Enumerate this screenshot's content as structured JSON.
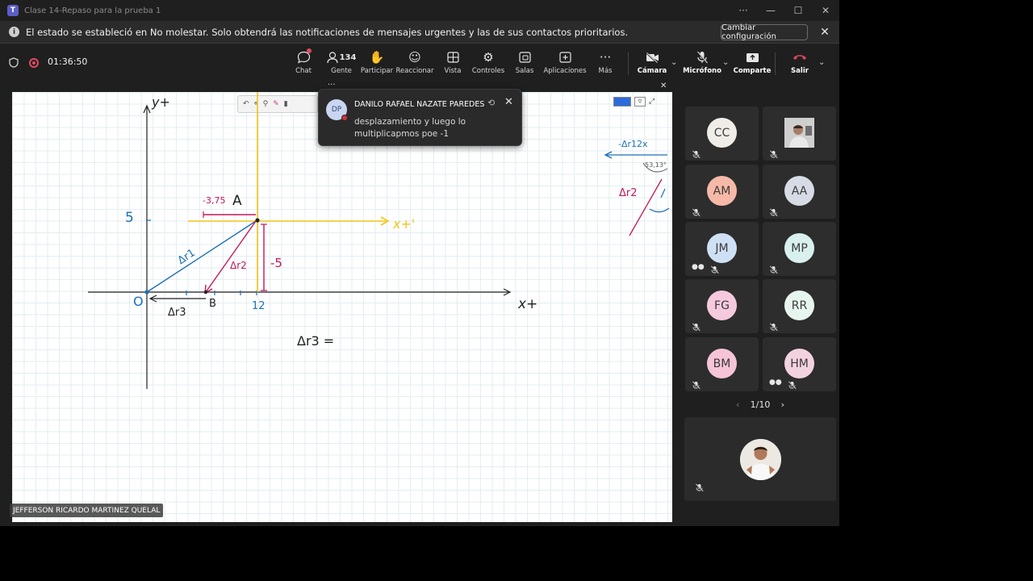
{
  "window": {
    "title": "Clase 14-Repaso para la prueba 1"
  },
  "banner": {
    "message": "El estado se estableció en No molestar. Solo obtendrá las notificaciones de mensajes urgentes y las de sus contactos prioritarios.",
    "config_label": "Cambiar configuración"
  },
  "meeting": {
    "timer": "01:36:50"
  },
  "toolbar": {
    "chat": "Chat",
    "people": "Gente",
    "people_count": "134",
    "raise": "Participar",
    "react": "Reaccionar",
    "view": "Vista",
    "controls": "Controles",
    "rooms": "Salas",
    "apps": "Aplicaciones",
    "more": "Más",
    "camera": "Cámara",
    "mic": "Micrófono",
    "share": "Comparte",
    "leave": "Salir"
  },
  "toast": {
    "initials": "DP",
    "sender": "DANILO RAFAEL NAZATE PAREDES",
    "message": "desplazamiento y luego lo multiplicapmos poe -1"
  },
  "presenter_name": "JEFFERSON RICARDO MARTINEZ QUELAL",
  "participants": [
    {
      "initials": "CC",
      "color": "#f0ede8"
    },
    {
      "initials": "",
      "color": "#d7d7d7"
    },
    {
      "initials": "AM",
      "color": "#f6b9a8"
    },
    {
      "initials": "AA",
      "color": "#d7dbe6"
    },
    {
      "initials": "JM",
      "color": "#cfe0f5"
    },
    {
      "initials": "MP",
      "color": "#d8f1ee"
    },
    {
      "initials": "FG",
      "color": "#f5c9de"
    },
    {
      "initials": "RR",
      "color": "#e6f6ef"
    },
    {
      "initials": "BM",
      "color": "#f5c4d7"
    },
    {
      "initials": "HM",
      "color": "#f3d2e0"
    }
  ],
  "pager": {
    "label": "1/10"
  },
  "whiteboard": {
    "labels": {
      "y_axis": "y+",
      "x_axis": "x+",
      "x_prime": "x+'",
      "five": "5",
      "origin": "O",
      "b": "B",
      "twelve": "12",
      "a": "A",
      "minus_375": "-3,75",
      "minus_5": "-5",
      "dr1": "Δr1",
      "dr2": "Δr2",
      "dr3": "Δr3",
      "dr13": "Δr3 =",
      "side_dr12x": "-Δr12x",
      "side_angle": "53,13°",
      "side_dr2": "Δr2"
    }
  }
}
